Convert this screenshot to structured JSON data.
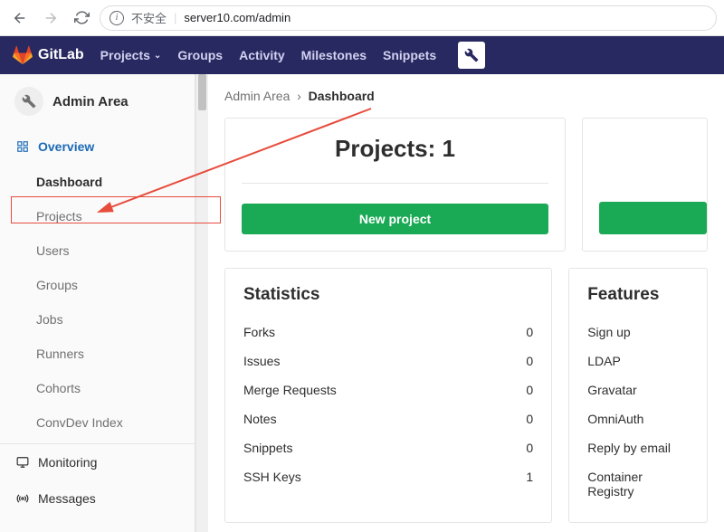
{
  "browser": {
    "security_warn": "不安全",
    "url": "server10.com/admin"
  },
  "topnav": {
    "brand": "GitLab",
    "links": {
      "projects": "Projects",
      "groups": "Groups",
      "activity": "Activity",
      "milestones": "Milestones",
      "snippets": "Snippets"
    }
  },
  "sidebar": {
    "title": "Admin Area",
    "overview": "Overview",
    "items": {
      "dashboard": "Dashboard",
      "projects": "Projects",
      "users": "Users",
      "groups": "Groups",
      "jobs": "Jobs",
      "runners": "Runners",
      "cohorts": "Cohorts",
      "convdev": "ConvDev Index"
    },
    "monitoring": "Monitoring",
    "messages": "Messages"
  },
  "breadcrumbs": {
    "root": "Admin Area",
    "current": "Dashboard"
  },
  "projects_card": {
    "title": "Projects: 1",
    "button": "New project"
  },
  "statistics": {
    "title": "Statistics",
    "rows": [
      {
        "label": "Forks",
        "value": "0"
      },
      {
        "label": "Issues",
        "value": "0"
      },
      {
        "label": "Merge Requests",
        "value": "0"
      },
      {
        "label": "Notes",
        "value": "0"
      },
      {
        "label": "Snippets",
        "value": "0"
      },
      {
        "label": "SSH Keys",
        "value": "1"
      }
    ]
  },
  "features": {
    "title": "Features",
    "rows": [
      "Sign up",
      "LDAP",
      "Gravatar",
      "OmniAuth",
      "Reply by email",
      "Container Registry"
    ]
  }
}
